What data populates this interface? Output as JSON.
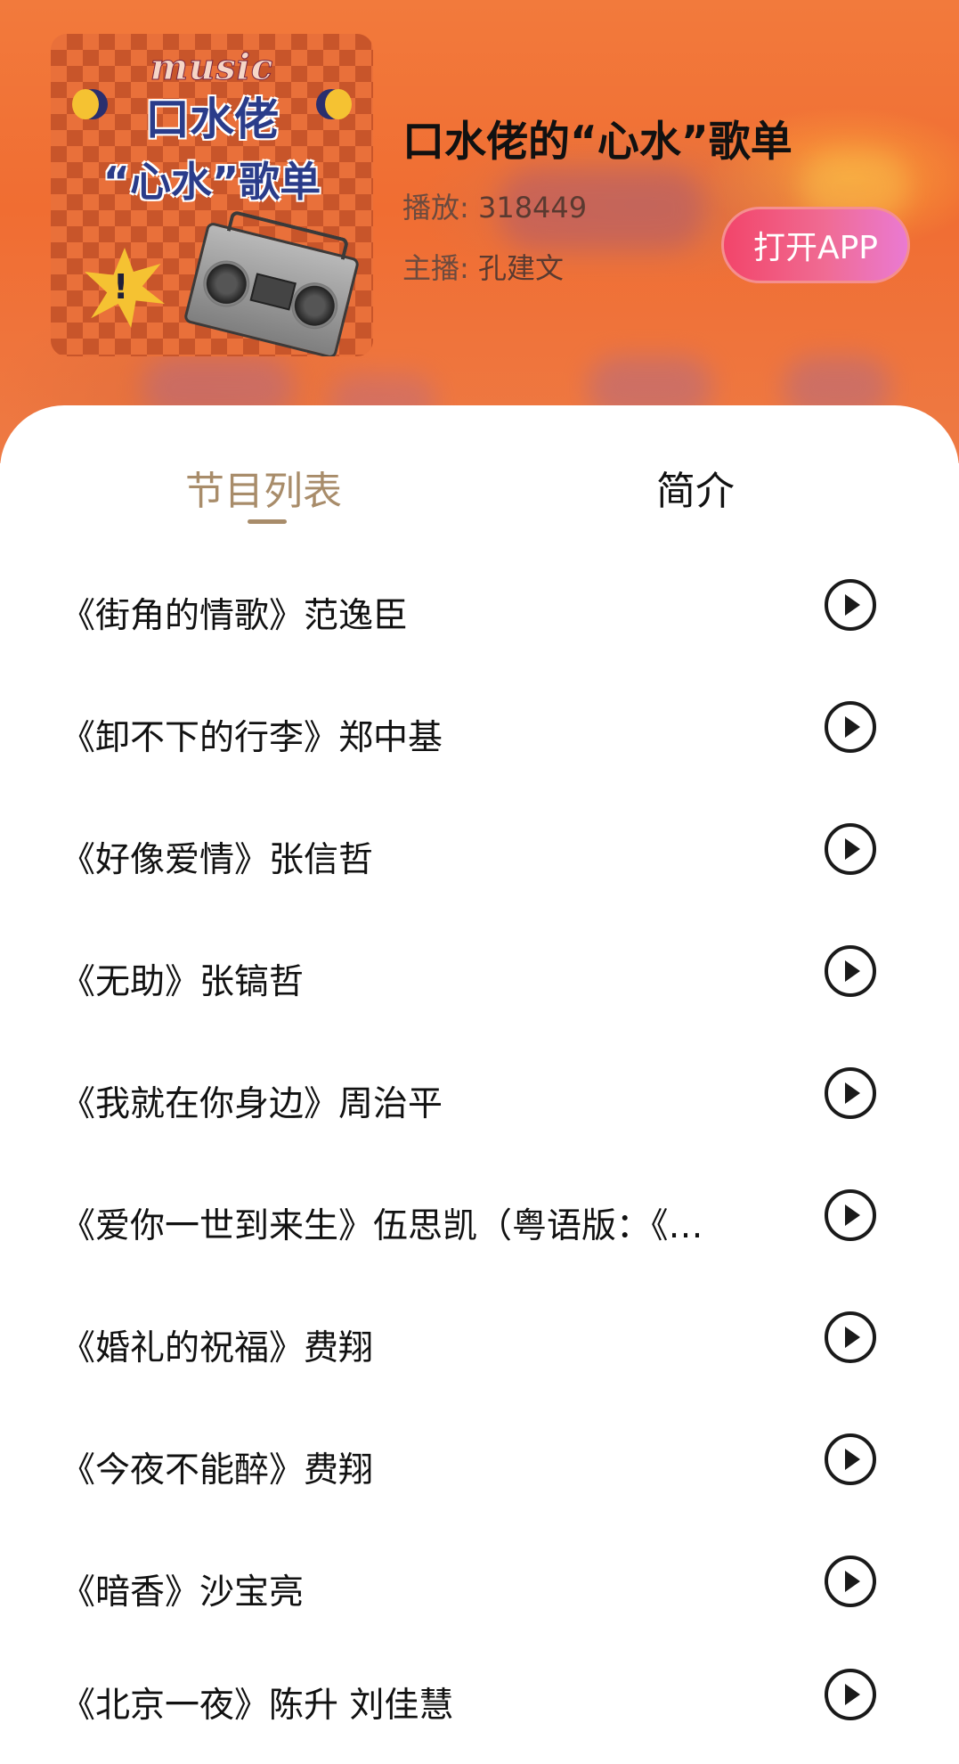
{
  "cover": {
    "word": "music",
    "line1": "口水佬",
    "line2": "“心水”歌单",
    "burst_mark": "!"
  },
  "header": {
    "title": "口水佬的“心水”歌单",
    "plays_label": "播放:",
    "plays_value": "318449",
    "host_label": "主播:",
    "host_value": "孔建文",
    "open_app": "打开APP"
  },
  "colors": {
    "header_orange": "#f06d32",
    "tab_active": "#a88c6a",
    "button_gradient_start": "#f2456a",
    "button_gradient_end": "#ea7ad2"
  },
  "tabs": [
    {
      "label": "节目列表",
      "active": true
    },
    {
      "label": "简介",
      "active": false
    }
  ],
  "tracks": [
    {
      "title": "《街角的情歌》范逸臣",
      "icon": "play-circle-icon"
    },
    {
      "title": "《卸不下的行李》郑中基",
      "icon": "play-circle-icon"
    },
    {
      "title": "《好像爱情》张信哲",
      "icon": "play-circle-icon"
    },
    {
      "title": "《无助》张镐哲",
      "icon": "play-circle-icon"
    },
    {
      "title": "《我就在你身边》周治平",
      "icon": "play-circle-icon"
    },
    {
      "title": "《爱你一世到来生》伍思凯（粤语版：《…",
      "icon": "play-circle-icon"
    },
    {
      "title": "《婚礼的祝福》费翔",
      "icon": "play-circle-icon"
    },
    {
      "title": "《今夜不能醉》费翔",
      "icon": "play-circle-icon"
    },
    {
      "title": "《暗香》沙宝亮",
      "icon": "play-circle-icon"
    },
    {
      "title": "《北京一夜》陈升 刘佳慧",
      "icon": "play-circle-icon"
    }
  ]
}
